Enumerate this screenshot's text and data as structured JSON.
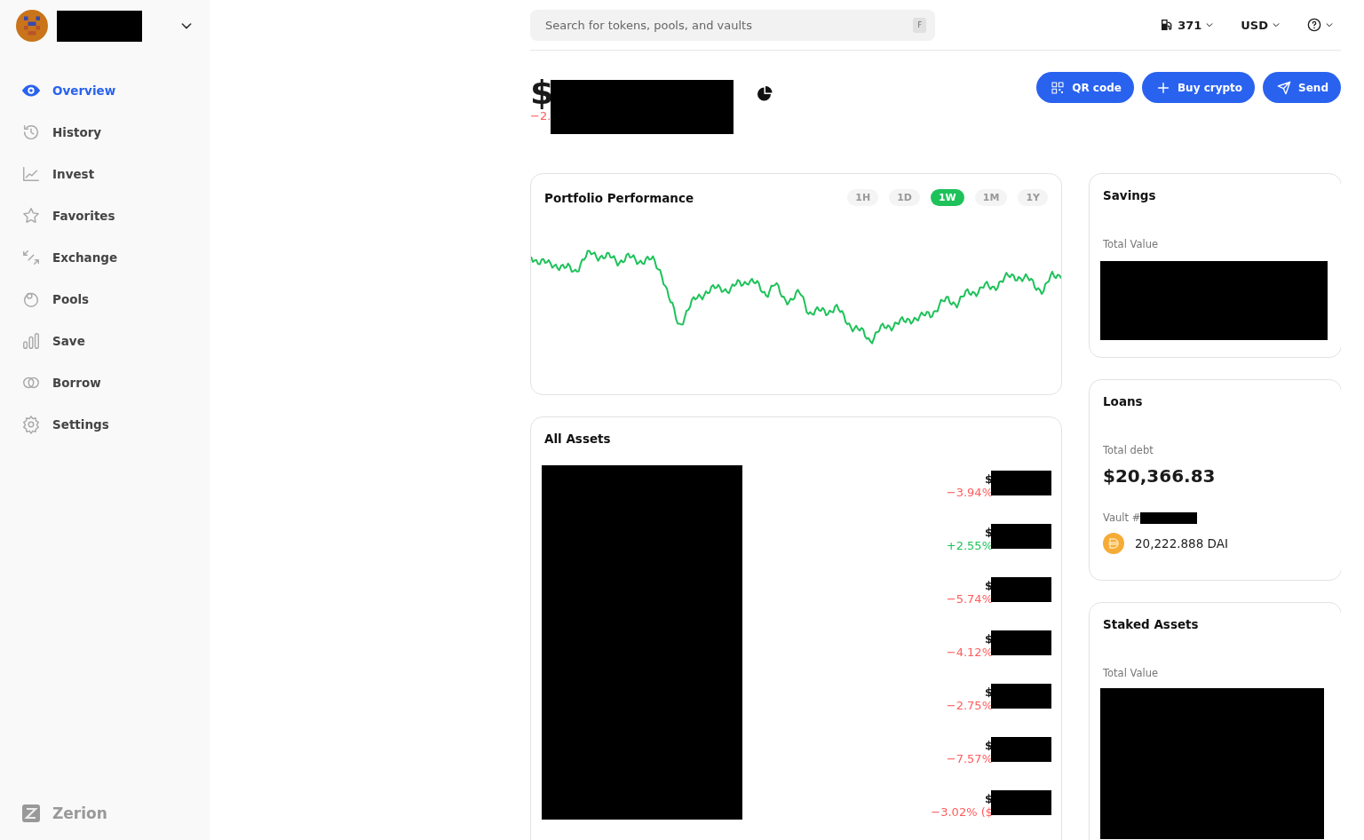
{
  "account": {
    "redacted": true
  },
  "nav": [
    {
      "label": "Overview",
      "selected": true
    },
    {
      "label": "History",
      "selected": false
    },
    {
      "label": "Invest",
      "selected": false
    },
    {
      "label": "Favorites",
      "selected": false
    },
    {
      "label": "Exchange",
      "selected": false
    },
    {
      "label": "Pools",
      "selected": false
    },
    {
      "label": "Save",
      "selected": false
    },
    {
      "label": "Borrow",
      "selected": false
    },
    {
      "label": "Settings",
      "selected": false
    }
  ],
  "brand": "Zerion",
  "search": {
    "placeholder": "Search for tokens, pools, and vaults",
    "shortcut": "F"
  },
  "topbar": {
    "gas": "371",
    "currency": "USD"
  },
  "balance": {
    "value": "$",
    "change": "−2.",
    "redacted": true
  },
  "actions": [
    "QR code",
    "Buy crypto",
    "Send"
  ],
  "performance": {
    "title": "Portfolio Performance",
    "ranges": [
      {
        "label": "1H",
        "selected": false
      },
      {
        "label": "1D",
        "selected": false
      },
      {
        "label": "1W",
        "selected": true
      },
      {
        "label": "1M",
        "selected": false
      },
      {
        "label": "1Y",
        "selected": false
      }
    ]
  },
  "assets": {
    "title": "All Assets",
    "redacted": true,
    "rows": [
      {
        "value": "$",
        "change": "−3.94%",
        "color": "#ff5c5c",
        "redacted": true
      },
      {
        "value": "$",
        "change": "+2.55%",
        "color": "#1ec25a",
        "redacted": true
      },
      {
        "value": "$",
        "change": "−5.74%",
        "color": "#ff5c5c",
        "redacted": true
      },
      {
        "value": "$",
        "change": "−4.12%",
        "color": "#ff5c5c",
        "redacted": true
      },
      {
        "value": "$",
        "change": "−2.75%",
        "color": "#ff5c5c",
        "redacted": true
      },
      {
        "value": "$",
        "change": "−7.57%",
        "color": "#ff5c5c",
        "redacted": true
      },
      {
        "value": "$",
        "change": "−3.02% ($",
        "color": "#ff5c5c",
        "redacted": true
      }
    ]
  },
  "savings": {
    "title": "Savings",
    "label": "Total Value",
    "redacted": true
  },
  "loans": {
    "title": "Loans",
    "label": "Total debt",
    "value": "$20,366.83",
    "vault": "Vault #",
    "vault_redacted": true,
    "token_amount": "20,222.888 DAI"
  },
  "staked": {
    "title": "Staked Assets",
    "label": "Total Value",
    "redacted": true
  }
}
